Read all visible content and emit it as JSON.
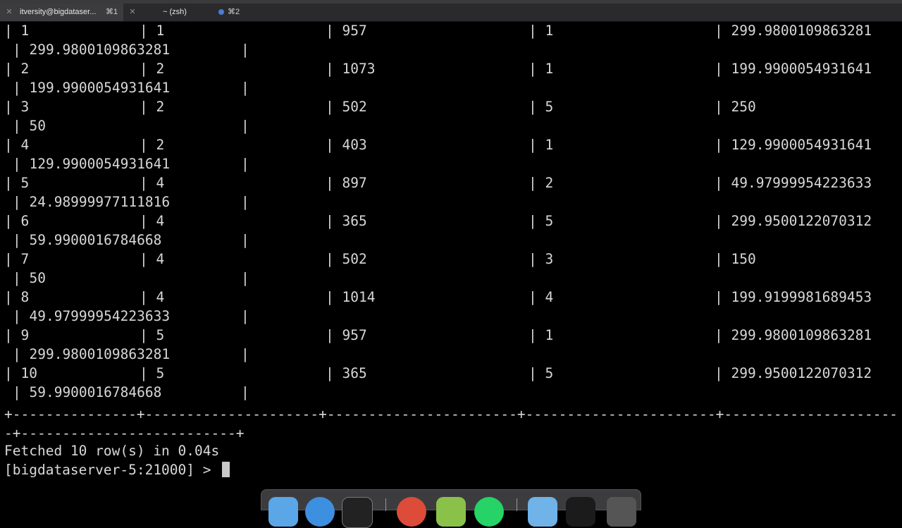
{
  "tabs": [
    {
      "title": "itversity@bigdataser...",
      "shortcut": "⌘1",
      "active": true
    },
    {
      "title": "~ (zsh)",
      "shortcut": ""
    },
    {
      "title": "",
      "shortcut": "⌘2"
    }
  ],
  "table": {
    "rows": [
      {
        "c1": "1",
        "c2": "1",
        "c3": "957",
        "c4": "1",
        "c5": "299.9800109863281",
        "c6": "299.9800109863281"
      },
      {
        "c1": "2",
        "c2": "2",
        "c3": "1073",
        "c4": "1",
        "c5": "199.9900054931641",
        "c6": "199.9900054931641"
      },
      {
        "c1": "3",
        "c2": "2",
        "c3": "502",
        "c4": "5",
        "c5": "250",
        "c6": "50"
      },
      {
        "c1": "4",
        "c2": "2",
        "c3": "403",
        "c4": "1",
        "c5": "129.9900054931641",
        "c6": "129.9900054931641"
      },
      {
        "c1": "5",
        "c2": "4",
        "c3": "897",
        "c4": "2",
        "c5": "49.97999954223633",
        "c6": "24.98999977111816"
      },
      {
        "c1": "6",
        "c2": "4",
        "c3": "365",
        "c4": "5",
        "c5": "299.9500122070312",
        "c6": "59.9900016784668"
      },
      {
        "c1": "7",
        "c2": "4",
        "c3": "502",
        "c4": "3",
        "c5": "150",
        "c6": "50"
      },
      {
        "c1": "8",
        "c2": "4",
        "c3": "1014",
        "c4": "4",
        "c5": "199.9199981689453",
        "c6": "49.97999954223633"
      },
      {
        "c1": "9",
        "c2": "5",
        "c3": "957",
        "c4": "1",
        "c5": "299.9800109863281",
        "c6": "299.9800109863281"
      },
      {
        "c1": "10",
        "c2": "5",
        "c3": "365",
        "c4": "5",
        "c5": "299.9500122070312",
        "c6": "59.9900016784668"
      }
    ],
    "separator_line1": "+---------------+---------------------+-----------------------+-----------------------+---------------------",
    "separator_line2": "-+--------------------------+"
  },
  "status": "Fetched 10 row(s) in 0.04s",
  "prompt": "[bigdataserver-5:21000] > ",
  "dock": {
    "icons": [
      "finder-icon",
      "safari-icon",
      "terminal-icon",
      "chrome-icon",
      "sublime-icon",
      "whatsapp-icon",
      "folder-icon",
      "app-icon",
      "trash-icon"
    ]
  }
}
